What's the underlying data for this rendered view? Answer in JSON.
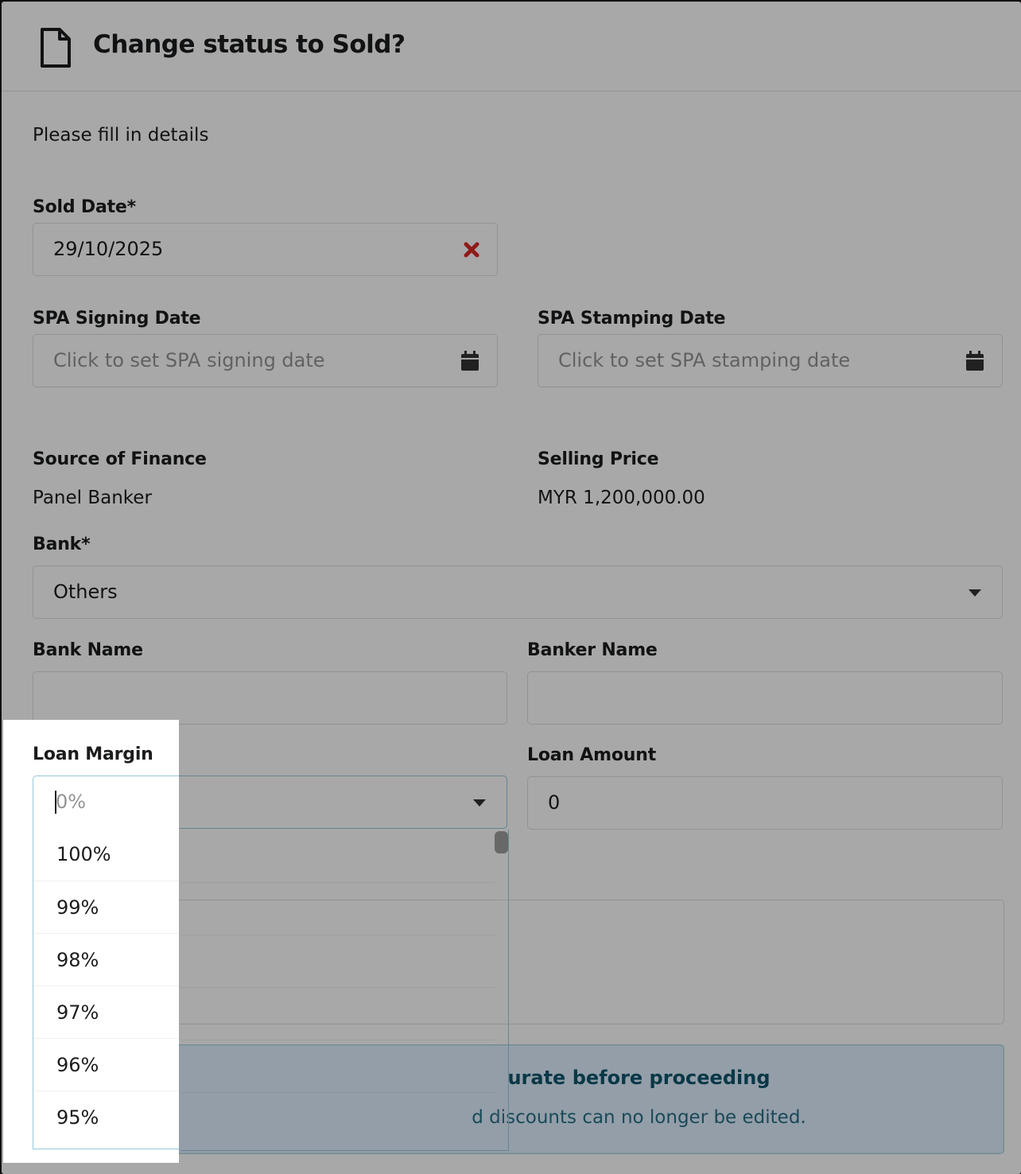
{
  "modal": {
    "title": "Change status to Sold?",
    "intro": "Please fill in details"
  },
  "sold_date": {
    "label": "Sold Date*",
    "value": "29/10/2025"
  },
  "spa_signing": {
    "label": "SPA Signing Date",
    "placeholder": "Click to set SPA signing date"
  },
  "spa_stamping": {
    "label": "SPA Stamping Date",
    "placeholder": "Click to set SPA stamping date"
  },
  "source_of_finance": {
    "label": "Source of Finance",
    "value": "Panel Banker"
  },
  "selling_price": {
    "label": "Selling Price",
    "value": "MYR 1,200,000.00"
  },
  "bank": {
    "label": "Bank*",
    "selected": "Others"
  },
  "bank_name": {
    "label": "Bank Name",
    "value": ""
  },
  "banker_name": {
    "label": "Banker Name",
    "value": ""
  },
  "loan_margin": {
    "label": "Loan Margin",
    "placeholder": "0%",
    "options": [
      "100%",
      "99%",
      "98%",
      "97%",
      "96%",
      "95%"
    ]
  },
  "loan_amount": {
    "label": "Loan Amount",
    "value": "0"
  },
  "message": {
    "header": "urate before proceeding",
    "body": "d discounts can no longer be edited."
  },
  "colors": {
    "info_bg": "#dff0ff",
    "clear_icon": "#db2828",
    "focus_border": "#96c8da"
  }
}
